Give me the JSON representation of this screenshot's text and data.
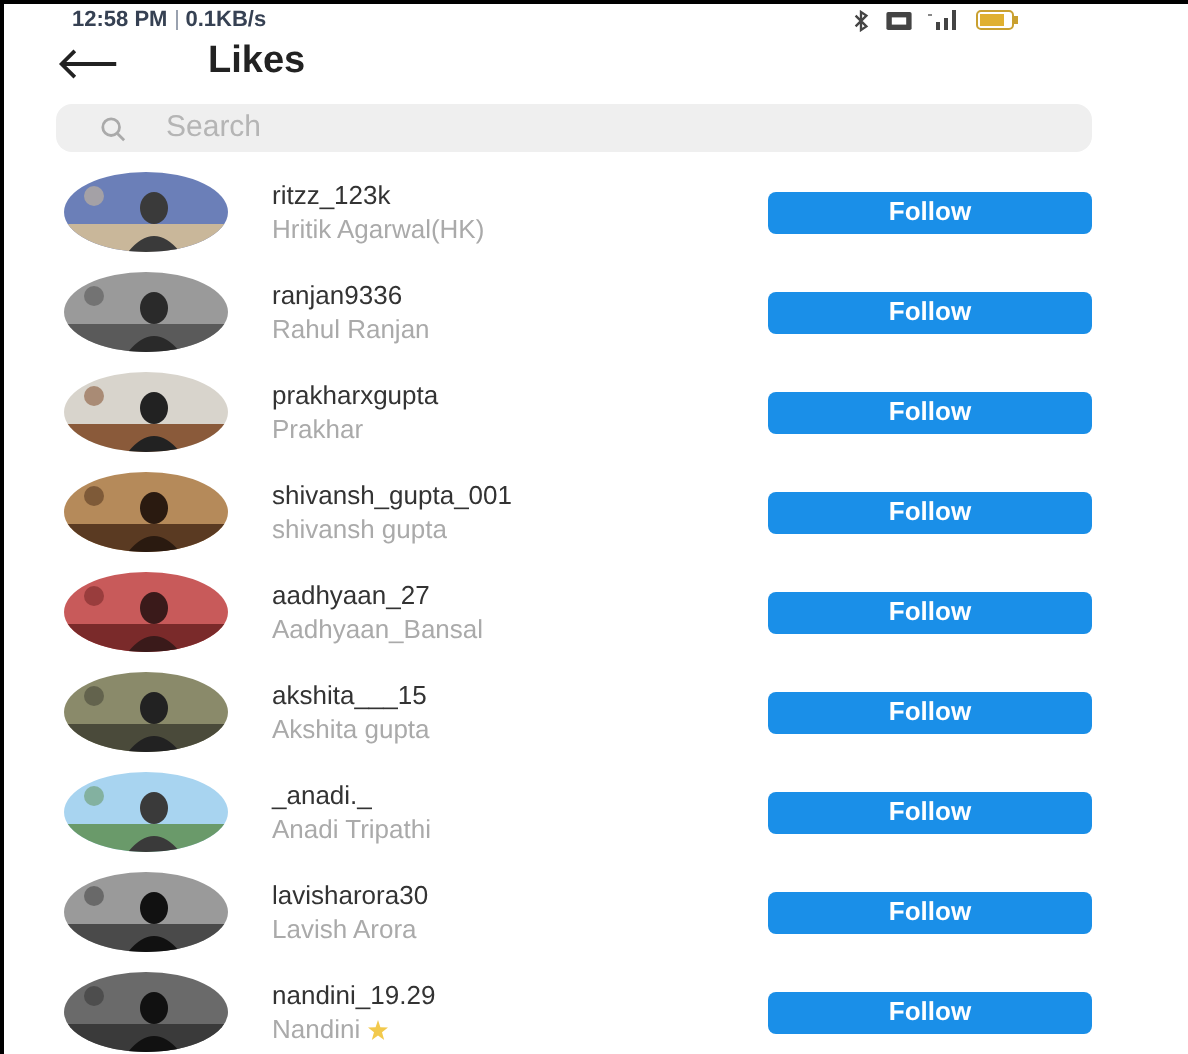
{
  "status_bar": {
    "time": "12:58 PM",
    "speed": "0.1KB/s"
  },
  "header": {
    "title": "Likes"
  },
  "search": {
    "placeholder": "Search"
  },
  "users": [
    {
      "username": "ritzz_123k",
      "name": "Hritik Agarwal(HK)",
      "button": "Follow"
    },
    {
      "username": "ranjan9336",
      "name": "Rahul Ranjan",
      "button": "Follow"
    },
    {
      "username": "prakharxgupta",
      "name": "Prakhar",
      "button": "Follow"
    },
    {
      "username": "shivansh_gupta_001",
      "name": "shivansh gupta",
      "button": "Follow"
    },
    {
      "username": "aadhyaan_27",
      "name": "Aadhyaan_Bansal",
      "button": "Follow"
    },
    {
      "username": "akshita___15",
      "name": "Akshita gupta",
      "button": "Follow"
    },
    {
      "username": "_anadi._",
      "name": "Anadi Tripathi",
      "button": "Follow"
    },
    {
      "username": "lavisharora30",
      "name": "Lavish Arora",
      "button": "Follow"
    },
    {
      "username": "nandini_19.29",
      "name": "Nandini",
      "button": "Follow",
      "star": true
    }
  ]
}
